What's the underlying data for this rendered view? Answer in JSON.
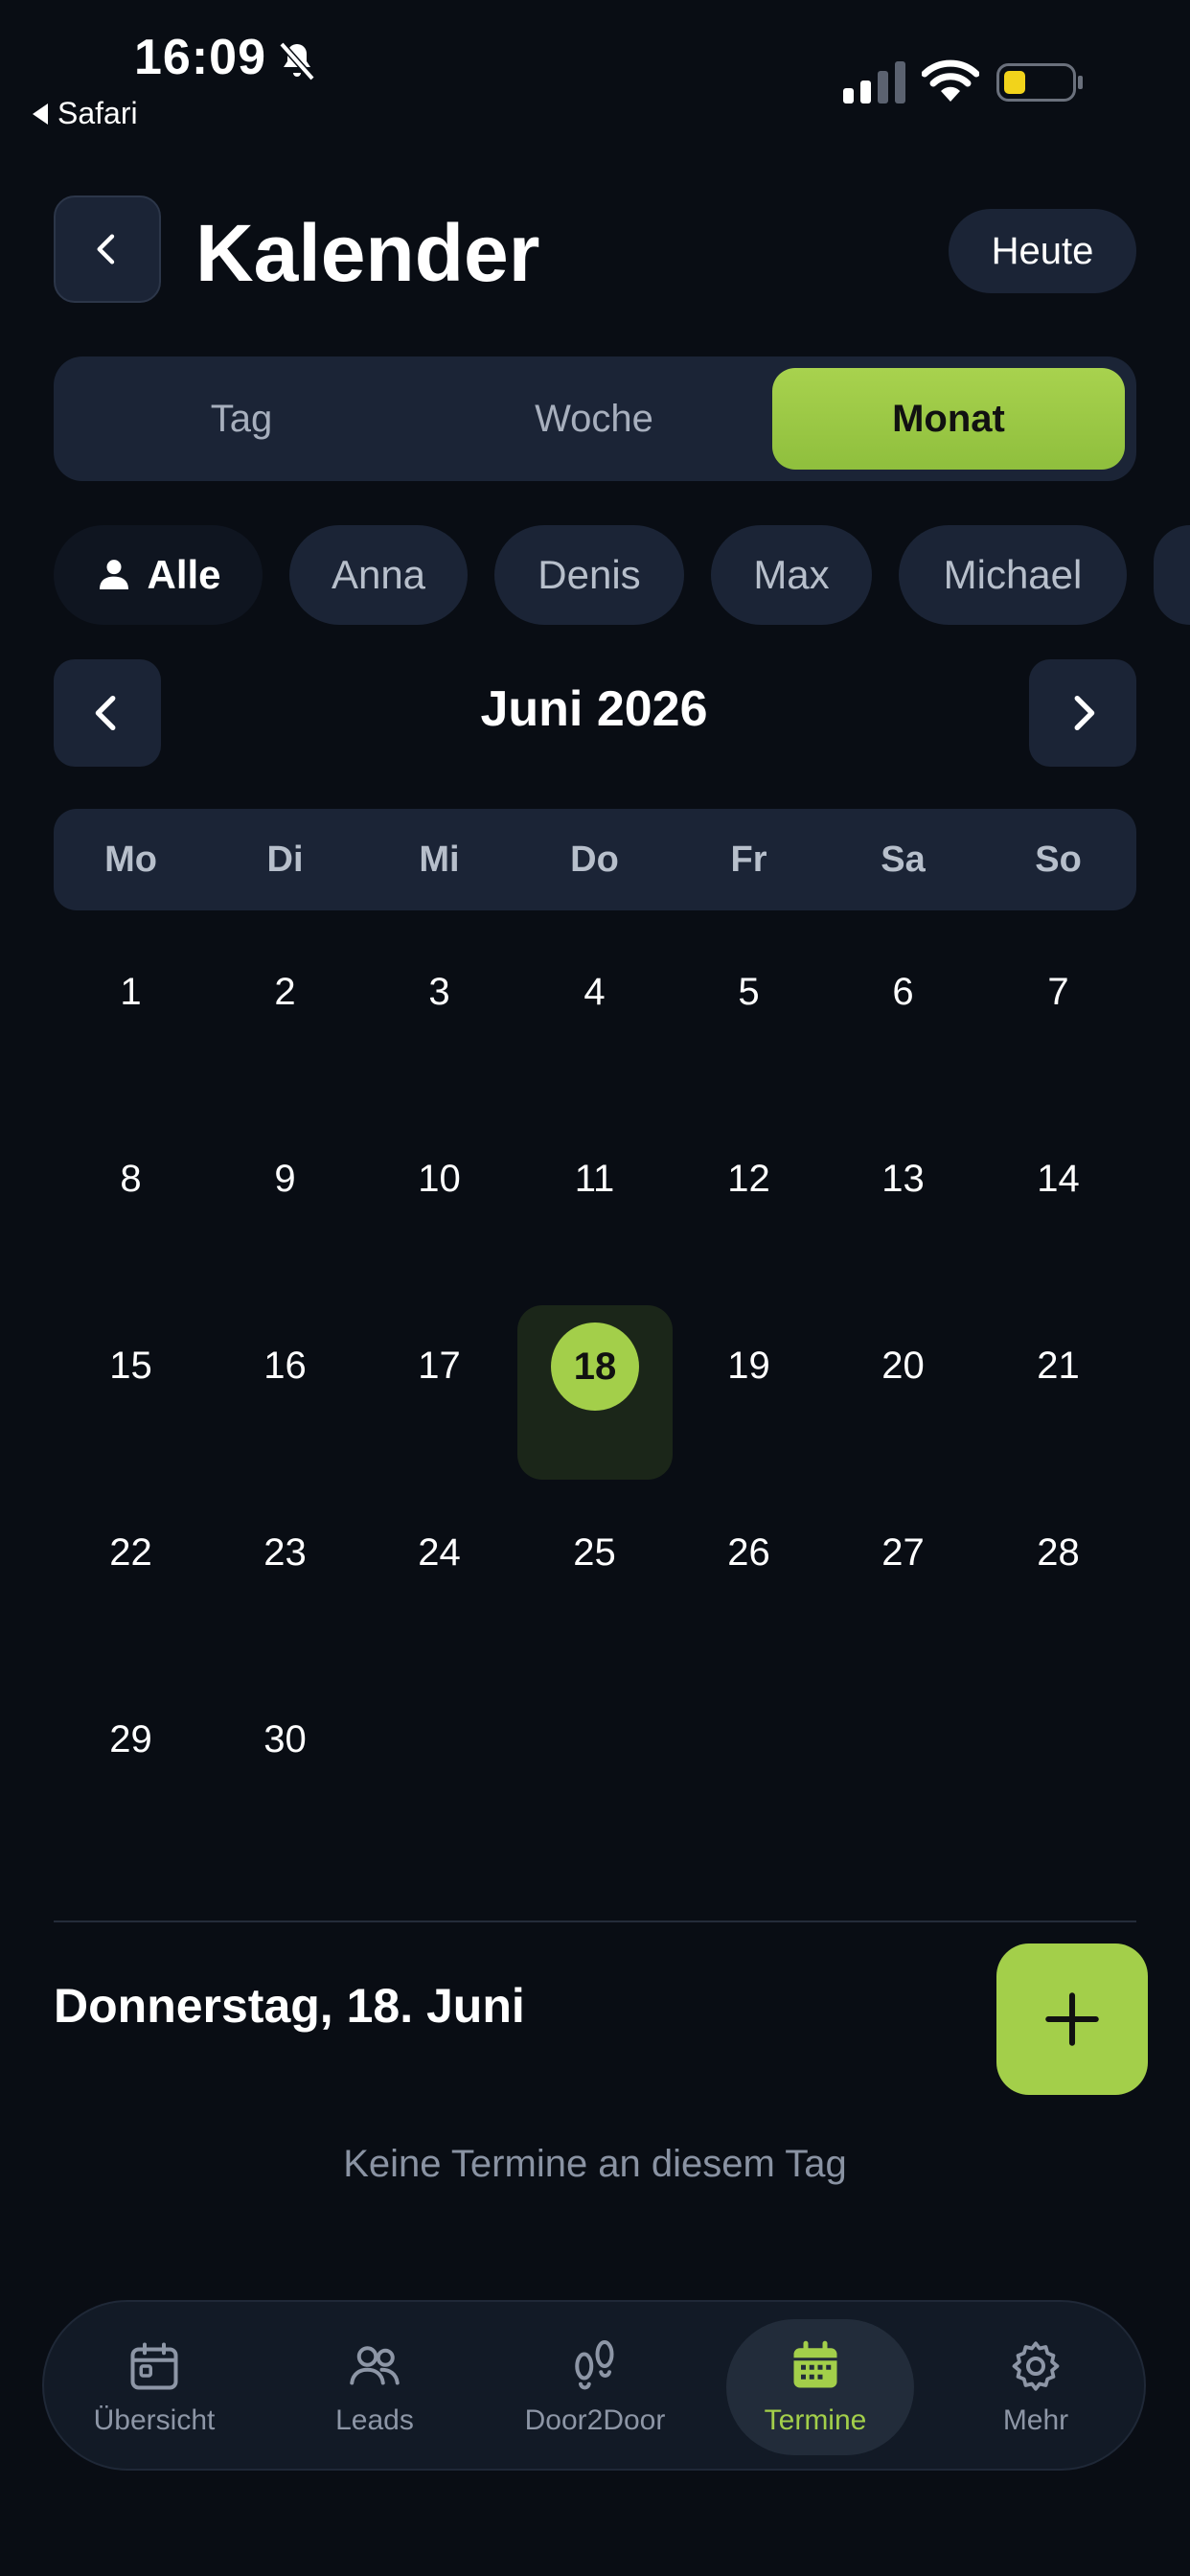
{
  "status": {
    "time": "16:09",
    "back_app": "Safari"
  },
  "header": {
    "title": "Kalender",
    "today_label": "Heute"
  },
  "view_tabs": [
    {
      "label": "Tag",
      "active": false
    },
    {
      "label": "Woche",
      "active": false
    },
    {
      "label": "Monat",
      "active": true
    }
  ],
  "filters": [
    {
      "label": "Alle",
      "active": true
    },
    {
      "label": "Anna",
      "active": false
    },
    {
      "label": "Denis",
      "active": false
    },
    {
      "label": "Max",
      "active": false
    },
    {
      "label": "Michael",
      "active": false
    }
  ],
  "calendar": {
    "month_label": "Juni 2026",
    "weekdays": [
      "Mo",
      "Di",
      "Mi",
      "Do",
      "Fr",
      "Sa",
      "So"
    ],
    "days": [
      "1",
      "2",
      "3",
      "4",
      "5",
      "6",
      "7",
      "8",
      "9",
      "10",
      "11",
      "12",
      "13",
      "14",
      "15",
      "16",
      "17",
      "18",
      "19",
      "20",
      "21",
      "22",
      "23",
      "24",
      "25",
      "26",
      "27",
      "28",
      "29",
      "30"
    ],
    "selected_day": "18"
  },
  "selected_date_heading": "Donnerstag, 18. Juni",
  "empty_message": "Keine Termine an diesem Tag",
  "bottom_nav": [
    {
      "label": "Übersicht",
      "icon": "overview-icon",
      "active": false
    },
    {
      "label": "Leads",
      "icon": "users-icon",
      "active": false
    },
    {
      "label": "Door2Door",
      "icon": "footprints-icon",
      "active": false
    },
    {
      "label": "Termine",
      "icon": "calendar-icon",
      "active": true
    },
    {
      "label": "Mehr",
      "icon": "gear-icon",
      "active": false
    }
  ],
  "colors": {
    "accent": "#a3cf4a",
    "background": "#090d14",
    "surface": "#1b2436"
  }
}
